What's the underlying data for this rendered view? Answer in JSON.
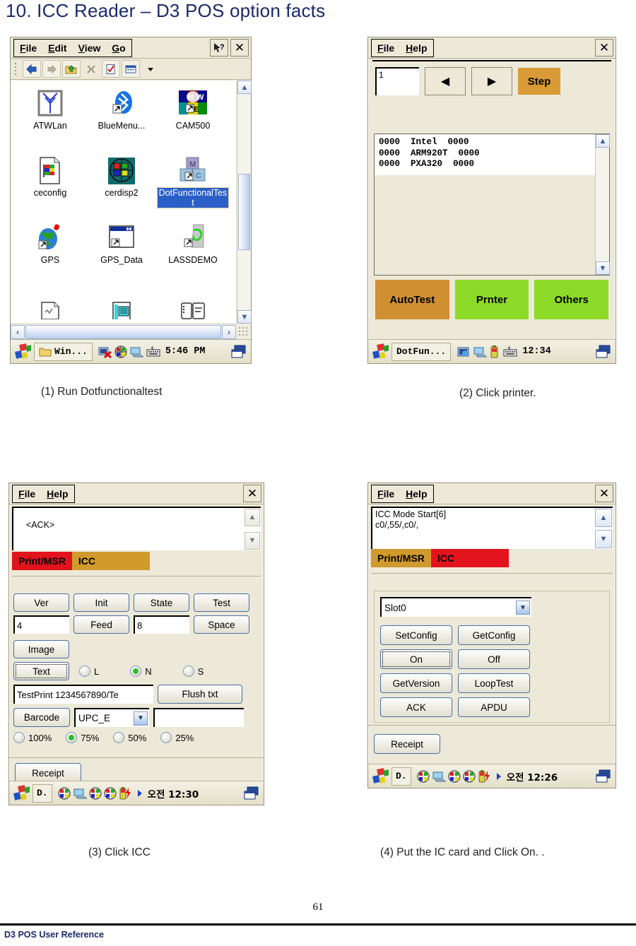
{
  "page": {
    "title": "10. ICC Reader – D3 POS option facts",
    "number": "61",
    "footer": "D3 POS User Reference"
  },
  "captions": {
    "one": "(1) Run Dotfunctionaltest",
    "two": "(2) Click printer.",
    "three": "(3) Click ICC",
    "four": "(4) Put the IC card and Click On. ."
  },
  "shot1": {
    "menu": [
      "File",
      "Edit",
      "View",
      "Go"
    ],
    "help_icon": "help-pointer-icon",
    "close_label": "✕",
    "toolbar_icons": [
      "back-icon",
      "forward-icon",
      "up-folder-icon",
      "delete-icon",
      "properties-icon",
      "views-icon",
      "chevron-down-icon"
    ],
    "icons": [
      {
        "label": "ATWLan",
        "art": "antenna"
      },
      {
        "label": "BlueMenu...",
        "art": "bluetooth"
      },
      {
        "label": "CAM500",
        "art": "cam500"
      },
      {
        "label": "ceconfig",
        "art": "doc-flag"
      },
      {
        "label": "cerdisp2",
        "art": "globe-win"
      },
      {
        "label": "DotFunctionalTest",
        "art": "blocks",
        "selected": true
      },
      {
        "label": "GPS",
        "art": "gps-globe"
      },
      {
        "label": "GPS_Data",
        "art": "window"
      },
      {
        "label": "LASSDEMO",
        "art": "lass"
      }
    ],
    "taskbar": {
      "start": "start-flag-icon",
      "task_label": "Win...",
      "task_icon": "folder-icon",
      "tray": [
        "network-error-icon",
        "ime-ball-icon",
        "desktop-icon",
        "keyboard-icon"
      ],
      "time": "5:46 PM",
      "switch_icon": "task-switch-icon"
    }
  },
  "shot2": {
    "menu": [
      "File",
      "Help"
    ],
    "close_label": "✕",
    "step_value": "1",
    "prev_label": "◀",
    "next_label": "▶",
    "step_label": "Step",
    "log_lines": [
      "0000  Intel  0000",
      "0000  ARM920T  0000",
      "0000  PXA320  0000"
    ],
    "buttons": [
      {
        "label": "AutoTest",
        "color": "#d08f32"
      },
      {
        "label": "Prnter",
        "color": "#8ddb28"
      },
      {
        "label": "Others",
        "color": "#8ddb28"
      }
    ],
    "taskbar": {
      "task_label": "DotFun...",
      "time": "12:34"
    }
  },
  "shot3": {
    "menu": [
      "File",
      "Help"
    ],
    "close_label": "✕",
    "log_text": "<ACK>",
    "tabs": [
      {
        "label": "Print/MSR",
        "color": "#e2131d",
        "active": true
      },
      {
        "label": "ICC",
        "color": "#d09a2c",
        "active": false
      }
    ],
    "buttons_row1": [
      "Ver",
      "Init",
      "State",
      "Test"
    ],
    "field_4": "4",
    "feed_label": "Feed",
    "field_8": "8",
    "space_label": "Space",
    "image_label": "Image",
    "text_label": "Text",
    "size_radios": [
      {
        "label": "L",
        "on": false
      },
      {
        "label": "N",
        "on": true
      },
      {
        "label": "S",
        "on": false
      }
    ],
    "print_text": "TestPrint 1234567890/Te",
    "flush_label": "Flush txt",
    "barcode_label": "Barcode",
    "barcode_type": "UPC_E",
    "barcode_value": "",
    "percent_radios": [
      {
        "label": "100%",
        "on": false
      },
      {
        "label": "75%",
        "on": true
      },
      {
        "label": "50%",
        "on": false
      },
      {
        "label": "25%",
        "on": false
      }
    ],
    "receipt_label": "Receipt",
    "taskbar": {
      "task_label": "D.",
      "time": "오전 12:30"
    }
  },
  "shot4": {
    "menu": [
      "File",
      "Help"
    ],
    "close_label": "✕",
    "log_lines": [
      "ICC Mode Start[6]",
      "c0/,55/,c0/,"
    ],
    "tabs": [
      {
        "label": "Print/MSR",
        "color": "#d09a2c",
        "active": false
      },
      {
        "label": "ICC",
        "color": "#e2131d",
        "active": true
      }
    ],
    "slot": "Slot0",
    "buttons": [
      {
        "label": "SetConfig",
        "focus": false
      },
      {
        "label": "GetConfig",
        "focus": false
      },
      {
        "label": "On",
        "focus": true
      },
      {
        "label": "Off",
        "focus": false
      },
      {
        "label": "GetVersion",
        "focus": false
      },
      {
        "label": "LoopTest",
        "focus": false
      },
      {
        "label": "ACK",
        "focus": false
      },
      {
        "label": "APDU",
        "focus": false
      }
    ],
    "receipt_label": "Receipt",
    "taskbar": {
      "task_label": "D.",
      "time": "오전 12:26"
    }
  }
}
